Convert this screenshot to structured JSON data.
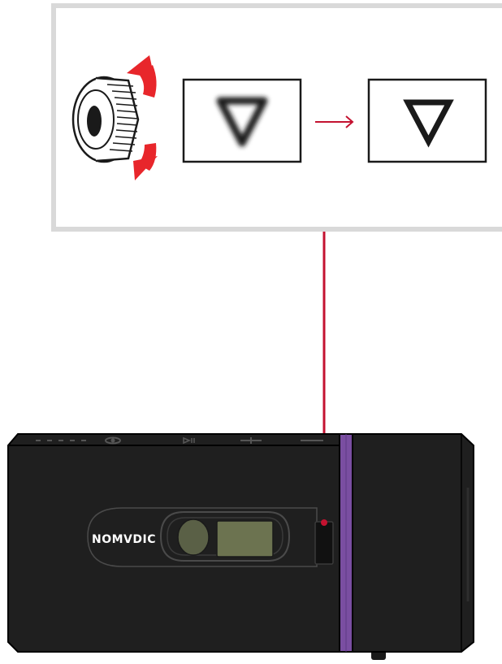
{
  "diagram": {
    "focus_illustration": {
      "dial_icon": "focus-dial-icon",
      "rotate_arrows_icon": "rotate-arrows-icon",
      "before_symbol": "▽",
      "after_symbol": "▽",
      "transition_icon": "right-arrow-icon"
    },
    "projector": {
      "brand_logo": "NOMVDIC",
      "top_button_icons": [
        "indicator-dots-icon",
        "home-icon",
        "play-pause-icon",
        "volume-up-icon",
        "volume-down-icon"
      ]
    },
    "colors": {
      "panel_border": "#d9d9d9",
      "callout_line": "#c41230",
      "rotate_arrows": "#e8262b",
      "body": "#1f1f1f",
      "accent_strip": "#7a4ea1",
      "lens": "#5a6046",
      "screen": "#6c7350"
    }
  }
}
